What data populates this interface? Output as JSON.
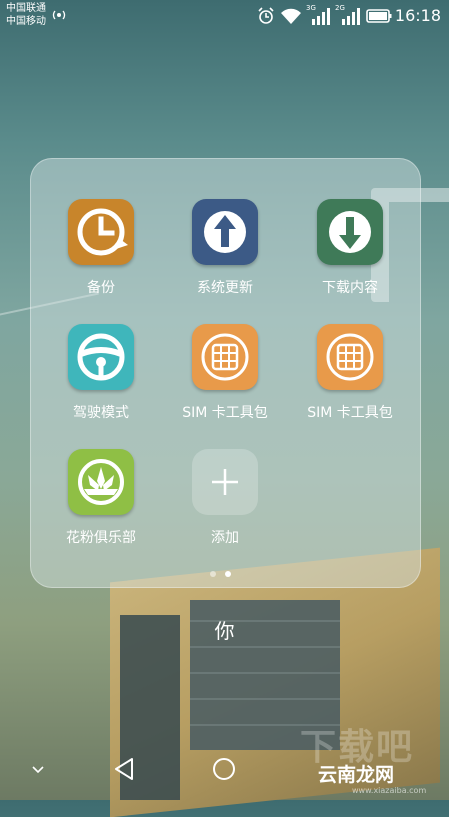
{
  "status_bar": {
    "carrier1": "中国联通",
    "carrier2": "中国移动",
    "net1": "3G",
    "net2": "2G",
    "time": "16:18"
  },
  "folder": {
    "title": "你",
    "apps": [
      {
        "label": "备份",
        "icon": "backup-clock-icon",
        "color": "#c8852b"
      },
      {
        "label": "系统更新",
        "icon": "upload-arrow-icon",
        "color": "#3c5a86"
      },
      {
        "label": "下载内容",
        "icon": "download-arrow-icon",
        "color": "#3f7a58"
      },
      {
        "label": "驾驶模式",
        "icon": "steering-wheel-icon",
        "color": "#3fb6bb"
      },
      {
        "label": "SIM 卡工具包",
        "icon": "sim-card-icon",
        "color": "#e89a4a"
      },
      {
        "label": "SIM 卡工具包",
        "icon": "sim-card-icon",
        "color": "#e89a4a"
      },
      {
        "label": "花粉俱乐部",
        "icon": "lotus-icon",
        "color": "#8fbf45"
      },
      {
        "label": "添加",
        "icon": "plus-icon",
        "color": "#ffffff"
      }
    ],
    "page_indicator": {
      "total": 2,
      "current": 2
    }
  },
  "watermark": {
    "text": "云南龙网",
    "bg_text": "下载吧",
    "url": "www.xiazaiba.com"
  }
}
